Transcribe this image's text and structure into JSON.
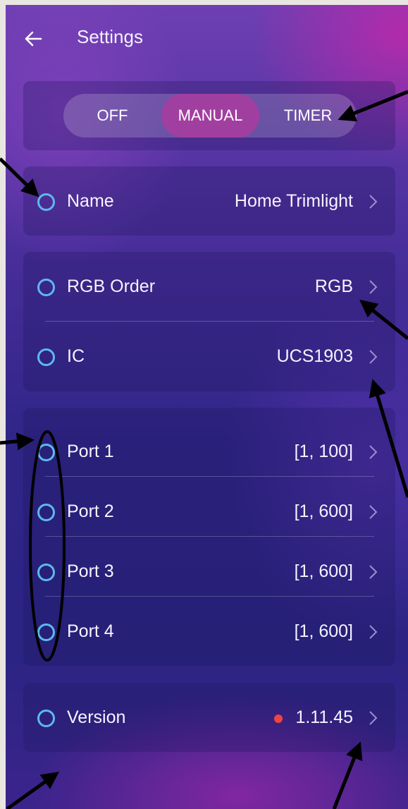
{
  "header": {
    "title": "Settings"
  },
  "mode_toggle": {
    "options": [
      "OFF",
      "MANUAL",
      "TIMER"
    ],
    "selected": "MANUAL"
  },
  "settings": {
    "name": {
      "label": "Name",
      "value": "Home Trimlight"
    },
    "rgb_order": {
      "label": "RGB Order",
      "value": "RGB"
    },
    "ic": {
      "label": "IC",
      "value": "UCS1903"
    },
    "ports": [
      {
        "label": "Port 1",
        "value": "[1, 100]"
      },
      {
        "label": "Port 2",
        "value": "[1, 600]"
      },
      {
        "label": "Port 3",
        "value": "[1, 600]"
      },
      {
        "label": "Port 4",
        "value": "[1, 600]"
      }
    ],
    "version": {
      "label": "Version",
      "value": "1.11.45"
    }
  },
  "colors": {
    "radio": "#5db9ee",
    "accent": "#aa3ca0",
    "update_dot": "#f0443f"
  }
}
